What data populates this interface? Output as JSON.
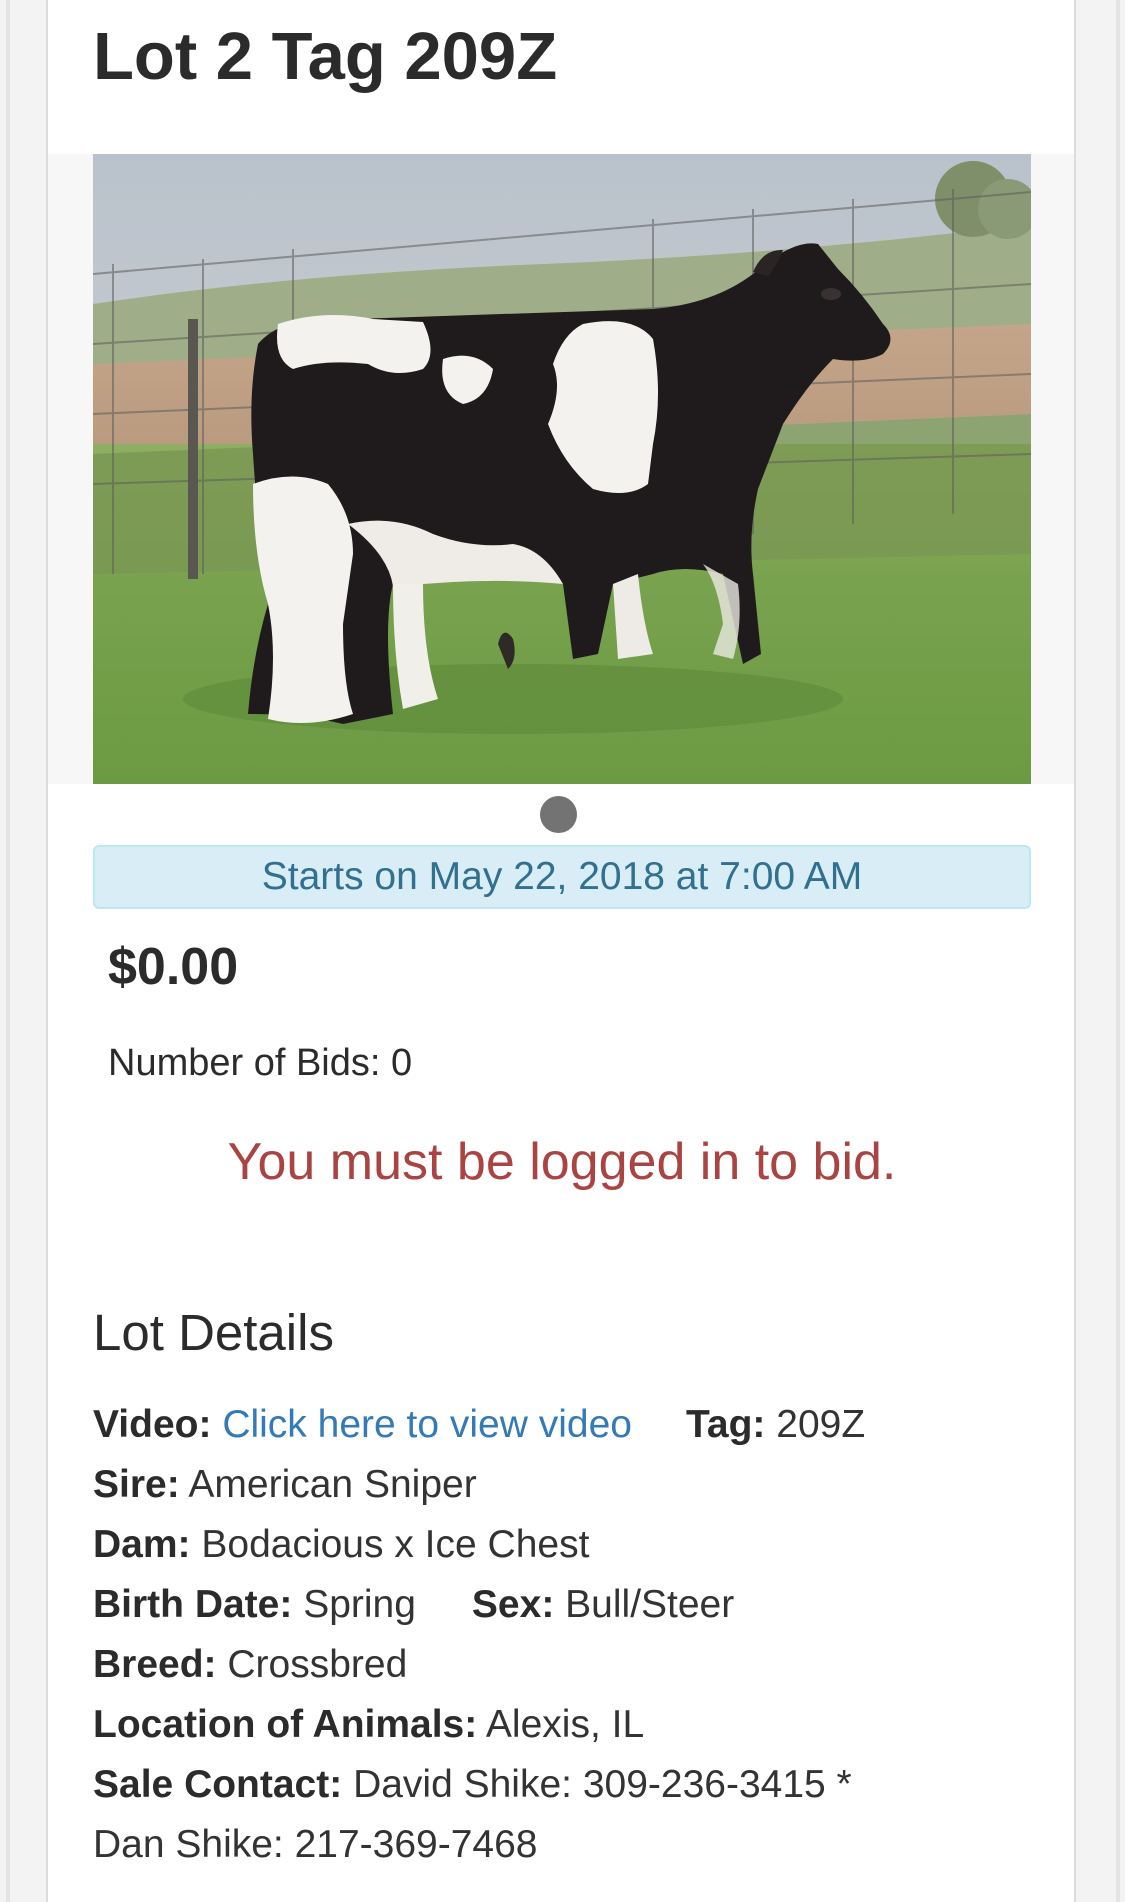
{
  "lot": {
    "title": "Lot 2 Tag 209Z",
    "photo_alt": "Black and white crossbred steer standing in grass",
    "start_banner": "Starts on May 22, 2018 at 7:00 AM",
    "price": "$0.00",
    "bids_text": "Number of Bids: 0",
    "login_message": "You must be logged in to bid."
  },
  "details": {
    "heading": "Lot Details",
    "video_label": "Video:",
    "video_link": "Click here to view video",
    "tag_label": "Tag:",
    "tag_value": "209Z",
    "sire_label": "Sire:",
    "sire_value": "American Sniper",
    "dam_label": "Dam:",
    "dam_value": "Bodacious x Ice Chest",
    "birth_label": "Birth Date:",
    "birth_value": "Spring",
    "sex_label": "Sex:",
    "sex_value": "Bull/Steer",
    "breed_label": "Breed:",
    "breed_value": "Crossbred",
    "location_label": "Location of Animals:",
    "location_value": "Alexis, IL",
    "contact_label": "Sale Contact:",
    "contact_value_1": "David Shike: 309-236-3415 *",
    "contact_value_2": "Dan Shike: 217-369-7468"
  },
  "colors": {
    "banner_bg": "#d9edf7",
    "banner_text": "#31708f",
    "alert_red": "#a94442",
    "link_blue": "#337ab7"
  }
}
